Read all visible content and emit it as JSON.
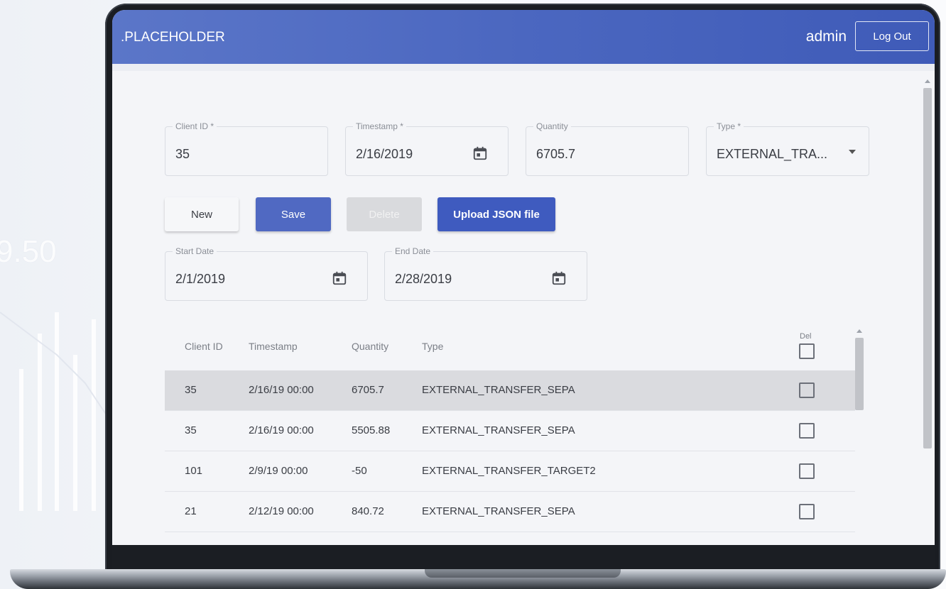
{
  "background": {
    "number": "9.50"
  },
  "header": {
    "title": ".PLACEHOLDER",
    "username": "admin",
    "logout_label": "Log Out"
  },
  "form": {
    "client_id": {
      "label": "Client ID *",
      "value": "35"
    },
    "timestamp": {
      "label": "Timestamp *",
      "value": "2/16/2019"
    },
    "quantity": {
      "label": "Quantity",
      "value": "6705.7"
    },
    "type": {
      "label": "Type *",
      "value": "EXTERNAL_TRA..."
    }
  },
  "actions": {
    "new_label": "New",
    "save_label": "Save",
    "delete_label": "Delete",
    "upload_label": "Upload JSON file"
  },
  "filters": {
    "start_date": {
      "label": "Start Date",
      "value": "2/1/2019"
    },
    "end_date": {
      "label": "End Date",
      "value": "2/28/2019"
    }
  },
  "table": {
    "columns": [
      "Client ID",
      "Timestamp",
      "Quantity",
      "Type",
      "Del"
    ],
    "rows": [
      {
        "client_id": "35",
        "timestamp": "2/16/19 00:00",
        "quantity": "6705.7",
        "type": "EXTERNAL_TRANSFER_SEPA"
      },
      {
        "client_id": "35",
        "timestamp": "2/16/19 00:00",
        "quantity": "5505.88",
        "type": "EXTERNAL_TRANSFER_SEPA"
      },
      {
        "client_id": "101",
        "timestamp": "2/9/19 00:00",
        "quantity": "-50",
        "type": "EXTERNAL_TRANSFER_TARGET2"
      },
      {
        "client_id": "21",
        "timestamp": "2/12/19 00:00",
        "quantity": "840.72",
        "type": "EXTERNAL_TRANSFER_SEPA"
      }
    ]
  },
  "colors": {
    "primary": "#3f5bbf",
    "appbar": "#4b67c0",
    "selected_row": "#dadbdf"
  }
}
